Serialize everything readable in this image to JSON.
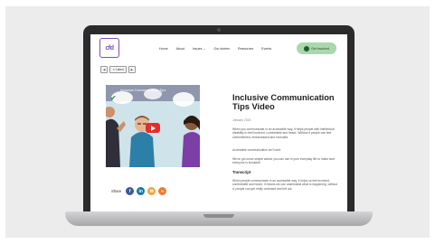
{
  "site": {
    "logo_text": "cfd",
    "nav": [
      "Home",
      "About",
      "Issues ⌄",
      "Our stories",
      "Resources",
      "Events"
    ],
    "cta_label": "Get involved"
  },
  "breadcrumbs": [
    "◀",
    "✕ Latest",
    "▶"
  ],
  "video": {
    "title": "Inclusive Communication Tips"
  },
  "share": {
    "label": "Share",
    "icons": [
      "facebook-icon",
      "linkedin-icon",
      "email-icon",
      "link-icon"
    ],
    "colors": [
      "#3b5998",
      "#0e76a8",
      "#f2a23a",
      "#f07a2c"
    ]
  },
  "article": {
    "title": "Inclusive Communication Tips Video",
    "date": "January 2024",
    "p1": "When you communicate in an accessible way, it helps people with intellectual disability to feel involved, comfortable and heard. Without it people can feel overwhelmed, embarrassed and excluded.",
    "p2": "Accessible communication isn't hard.",
    "p3": "We've got some simple advice you can use in your everyday life to make sure everyone is included!",
    "subhead": "Transcript",
    "p4": "When people communicate in an accessible way, it helps us feel involved, comfortable and heard. It means we can understand what is happening, without it, people can get really confused and left out."
  }
}
